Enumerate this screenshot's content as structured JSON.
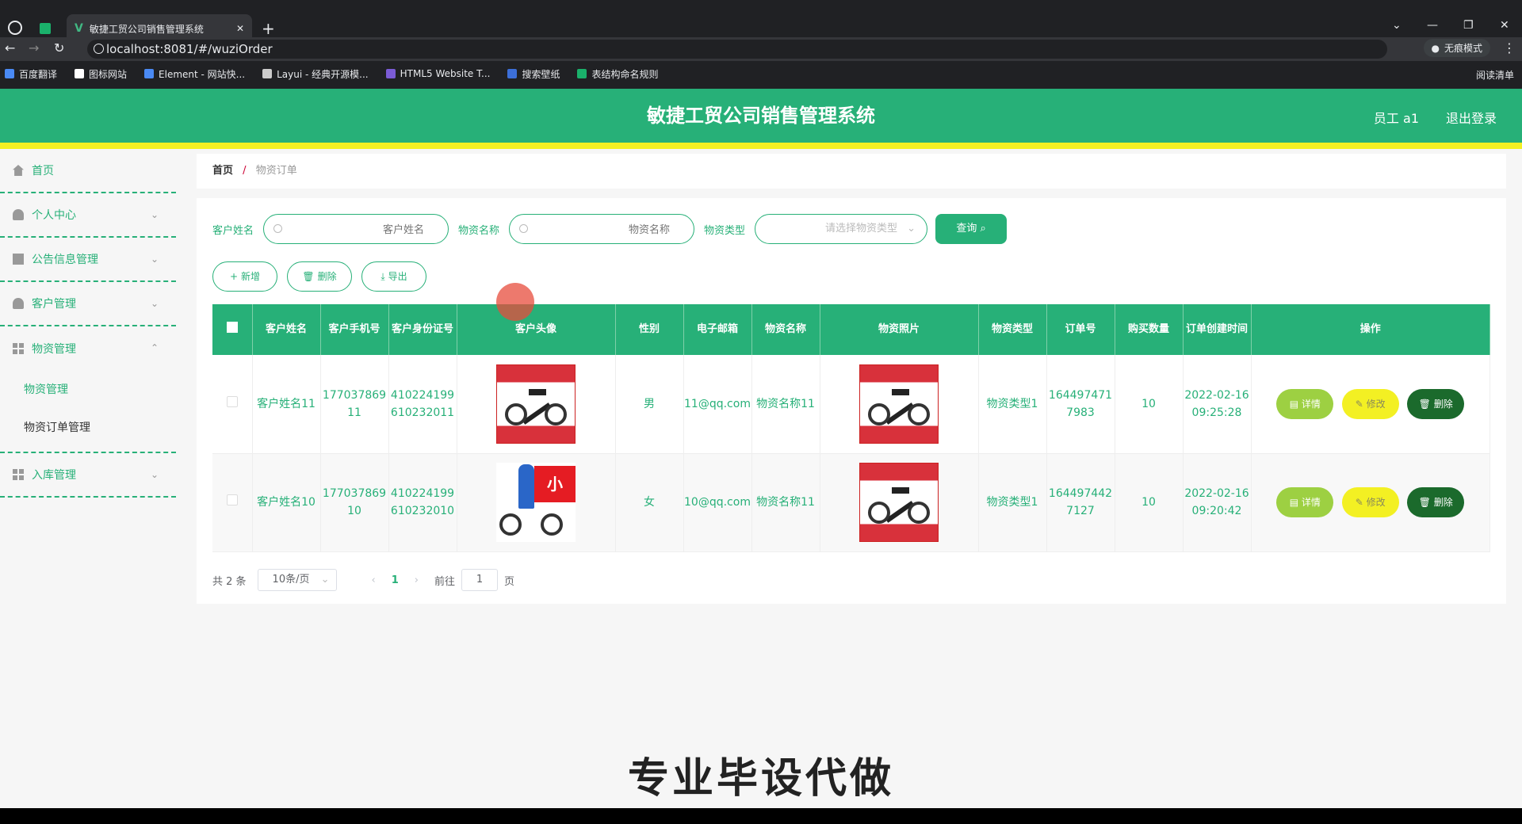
{
  "browser": {
    "tab_title": "敏捷工贸公司销售管理系统",
    "url": "localhost:8081/#/wuziOrder",
    "incognito_label": "无痕模式",
    "reading_list": "阅读清单",
    "bookmarks": [
      "百度翻译",
      "图标网站",
      "Element - 网站快...",
      "Layui - 经典开源模...",
      "HTML5 Website T...",
      "搜索壁纸",
      "表结构命名规则"
    ]
  },
  "header": {
    "title": "敏捷工贸公司销售管理系统",
    "user": "员工 a1",
    "logout": "退出登录",
    "color": "#27b078",
    "accent": "#f3f023"
  },
  "sidebar": {
    "items": [
      {
        "label": "首页",
        "icon": "house-icon"
      },
      {
        "label": "个人中心",
        "icon": "person-icon"
      },
      {
        "label": "公告信息管理",
        "icon": "notice-icon"
      },
      {
        "label": "客户管理",
        "icon": "person-icon"
      },
      {
        "label": "物资管理",
        "icon": "grid-icon"
      },
      {
        "label": "入库管理",
        "icon": "grid-icon"
      }
    ],
    "submenu": [
      "物资管理",
      "物资订单管理"
    ]
  },
  "breadcrumb": {
    "home": "首页",
    "current": "物资订单"
  },
  "search": {
    "customer_label": "客户姓名",
    "customer_placeholder": "客户姓名",
    "goods_label": "物资名称",
    "goods_placeholder": "物资名称",
    "type_label": "物资类型",
    "type_placeholder": "请选择物资类型",
    "query_label": "查询"
  },
  "actions": {
    "add": "新增",
    "delete": "删除",
    "export": "导出"
  },
  "table": {
    "headers": [
      "客户姓名",
      "客户手机号",
      "客户身份证号",
      "客户头像",
      "性别",
      "电子邮箱",
      "物资名称",
      "物资照片",
      "物资类型",
      "订单号",
      "购买数量",
      "订单创建时间",
      "操作"
    ],
    "rows": [
      {
        "name": "客户姓名11",
        "phone": "17703786911",
        "idcard": "410224199610232011",
        "gender": "男",
        "email": "11@qq.com",
        "goods": "物资名称11",
        "type": "物资类型1",
        "order_no": "1644974717983",
        "qty": "10",
        "created": "2022-02-16 09:25:28"
      },
      {
        "name": "客户姓名10",
        "phone": "17703786910",
        "idcard": "410224199610232010",
        "gender": "女",
        "email": "10@qq.com",
        "goods": "物资名称11",
        "type": "物资类型1",
        "order_no": "1644974427127",
        "qty": "10",
        "created": "2022-02-16 09:20:42"
      }
    ],
    "op_detail": "详情",
    "op_edit": "修改",
    "op_delete": "删除"
  },
  "pager": {
    "total": "共 2 条",
    "size": "10条/页",
    "current": "1",
    "goto": "前往",
    "goto_value": "1",
    "page_suffix": "页"
  },
  "watermark": "专业毕设代做"
}
